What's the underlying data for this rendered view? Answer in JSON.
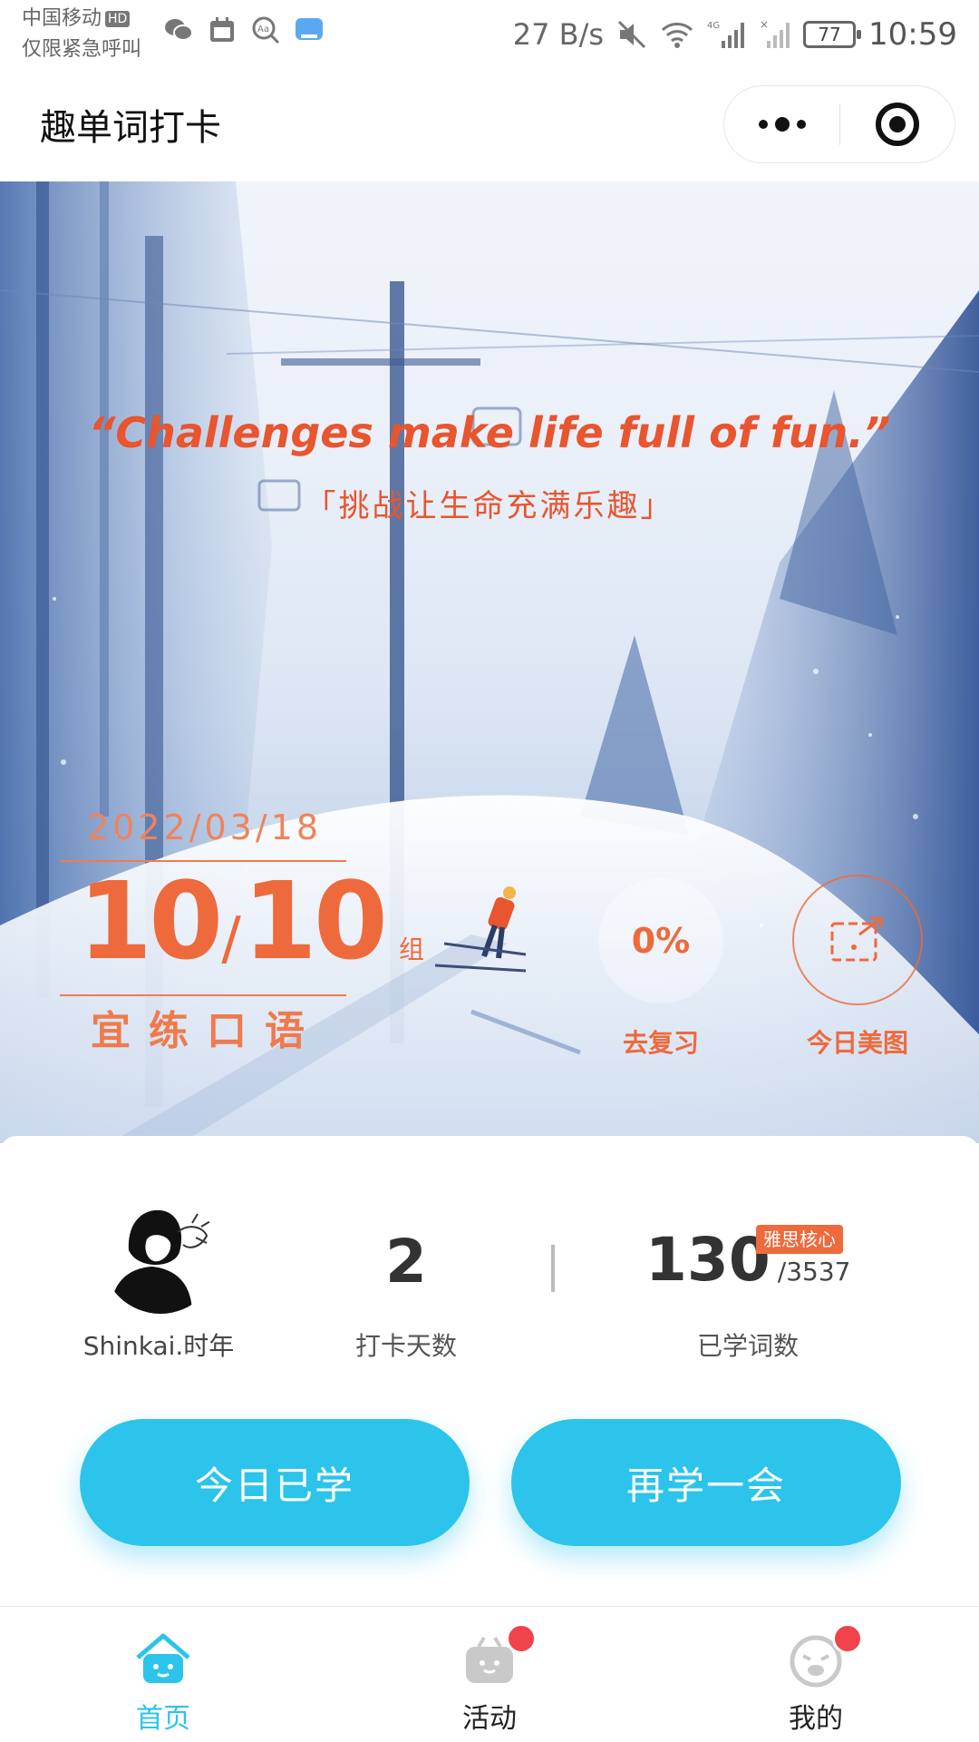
{
  "status_bar": {
    "carrier": "中国移动",
    "carrier_badge": "HD",
    "emergency": "仅限紧急呼叫",
    "net_speed": "27 B/s",
    "battery": "77",
    "time": "10:59"
  },
  "title_bar": {
    "title": "趣单词打卡"
  },
  "hero": {
    "quote_en": "“Challenges make life full of fun.”",
    "quote_zh": "「挑战让生命充满乐趣」",
    "date": "2022/03/18",
    "groups_done": "10",
    "groups_separator": "/",
    "groups_total": "10",
    "groups_unit": "组",
    "advice": "宜练口语",
    "review_percent": "0%",
    "review_label": "去复习",
    "photo_label": "今日美图"
  },
  "stats": {
    "username": "Shinkai.时年",
    "checkin_days": "2",
    "checkin_days_label": "打卡天数",
    "words_learned": "130",
    "words_total": "/3537",
    "wordbook_badge": "雅思核心",
    "words_label": "已学词数"
  },
  "actions": {
    "today_learned": "今日已学",
    "learn_more": "再学一会"
  },
  "tabs": [
    {
      "label": "首页",
      "icon": "home-icon",
      "active": true
    },
    {
      "label": "活动",
      "icon": "activity-icon",
      "active": false,
      "has_dot": true
    },
    {
      "label": "我的",
      "icon": "profile-icon",
      "active": false,
      "has_dot": true
    }
  ],
  "colors": {
    "accent": "#2cc4ea",
    "quote": "#e8552e",
    "badge": "#ee6a3c",
    "notification_dot": "#f0434b"
  }
}
